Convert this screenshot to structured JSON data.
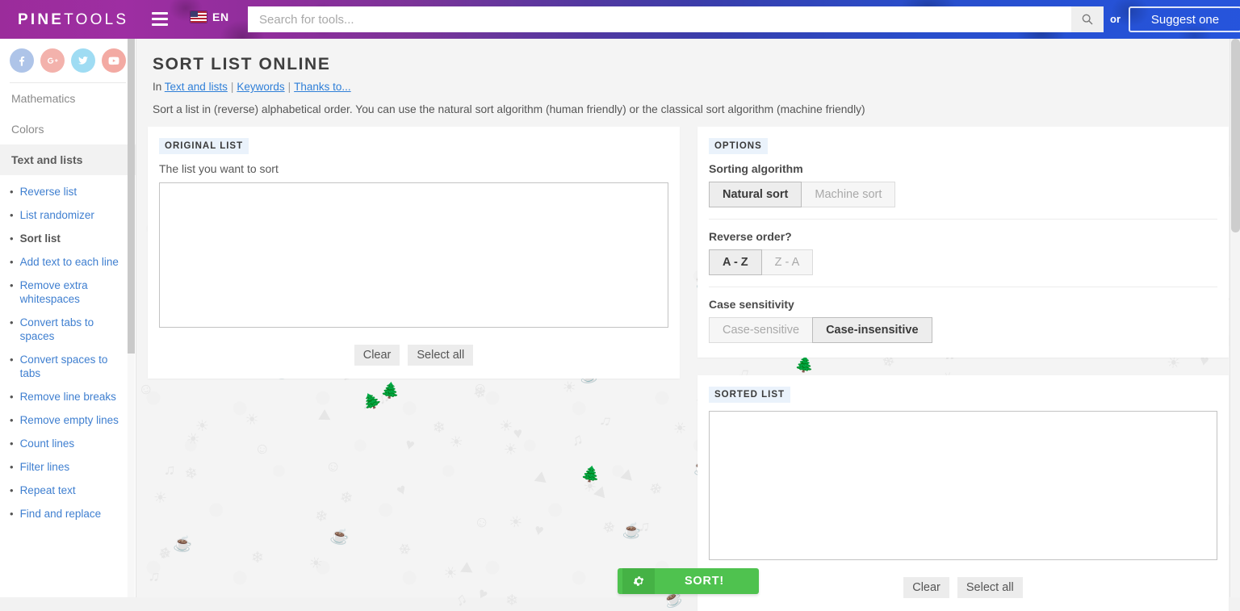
{
  "header": {
    "logo_bold": "PINE",
    "logo_light": "TOOLS",
    "menu_icon": "hamburger-icon",
    "lang_code": "EN",
    "flag": "us-flag-icon",
    "search": {
      "placeholder": "Search for tools...",
      "value": "",
      "icon": "search-icon"
    },
    "or_label": "or",
    "suggest_label": "Suggest one",
    "gradient_from": "#9b2c9b",
    "gradient_to": "#2a5ae0"
  },
  "sidebar": {
    "social": [
      {
        "name": "facebook",
        "glyph": "f",
        "color": "#aec4e8"
      },
      {
        "name": "google-plus",
        "glyph": "G+",
        "color": "#f3b2ac"
      },
      {
        "name": "twitter",
        "glyph": "t",
        "color": "#9fdcf3"
      },
      {
        "name": "youtube",
        "glyph": "▶",
        "color": "#f3aaa3"
      }
    ],
    "categories": [
      {
        "label": "Mathematics",
        "active": false
      },
      {
        "label": "Colors",
        "active": false
      },
      {
        "label": "Text and lists",
        "active": true
      }
    ],
    "tools": [
      {
        "label": "Reverse list",
        "current": false
      },
      {
        "label": "List randomizer",
        "current": false
      },
      {
        "label": "Sort list",
        "current": true
      },
      {
        "label": "Add text to each line",
        "current": false
      },
      {
        "label": "Remove extra whitespaces",
        "current": false
      },
      {
        "label": "Convert tabs to spaces",
        "current": false
      },
      {
        "label": "Convert spaces to tabs",
        "current": false
      },
      {
        "label": "Remove line breaks",
        "current": false
      },
      {
        "label": "Remove empty lines",
        "current": false
      },
      {
        "label": "Count lines",
        "current": false
      },
      {
        "label": "Filter lines",
        "current": false
      },
      {
        "label": "Repeat text",
        "current": false
      },
      {
        "label": "Find and replace",
        "current": false
      }
    ]
  },
  "page": {
    "title": "SORT LIST ONLINE",
    "breadcrumb_prefix": "In",
    "breadcrumb_links": [
      "Text and lists",
      "Keywords",
      "Thanks to..."
    ],
    "breadcrumb_separator": "|",
    "description": "Sort a list in (reverse) alphabetical order. You can use the natural sort algorithm (human friendly) or the classical sort algorithm (machine friendly)"
  },
  "original_list": {
    "tag": "ORIGINAL LIST",
    "field_label": "The list you want to sort",
    "value": "",
    "placeholder": "",
    "clear_label": "Clear",
    "select_all_label": "Select all"
  },
  "options": {
    "tag": "OPTIONS",
    "groups": [
      {
        "label": "Sorting algorithm",
        "choices": [
          "Natural sort",
          "Machine sort"
        ],
        "selected": "Natural sort"
      },
      {
        "label": "Reverse order?",
        "choices": [
          "A - Z",
          "Z - A"
        ],
        "selected": "A - Z"
      },
      {
        "label": "Case sensitivity",
        "choices": [
          "Case-sensitive",
          "Case-insensitive"
        ],
        "selected": "Case-insensitive"
      }
    ]
  },
  "sorted_list": {
    "tag": "SORTED LIST",
    "value": "",
    "placeholder": "",
    "clear_label": "Clear",
    "select_all_label": "Select all"
  },
  "action": {
    "label": "SORT!",
    "icon": "gear-icon",
    "color": "#4fc24f"
  }
}
